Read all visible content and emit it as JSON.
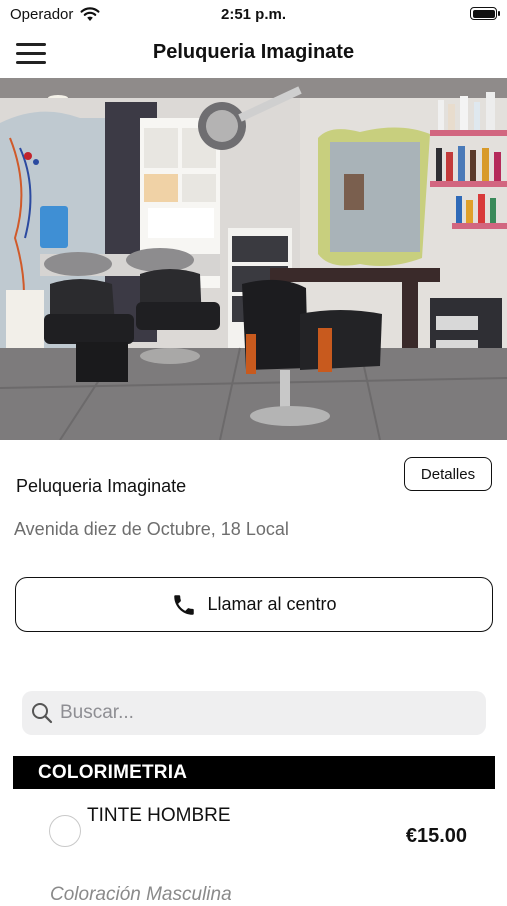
{
  "status_bar": {
    "carrier": "Operador",
    "time": "2:51 p.m."
  },
  "nav": {
    "title": "Peluqueria Imaginate",
    "menu_icon": "hamburger-menu-icon"
  },
  "hero": {
    "image_type": "photo of hair salon interior"
  },
  "salon": {
    "name": "Peluqueria Imaginate",
    "address": "Avenida diez de Octubre, 18 Local",
    "details_label": "Detalles",
    "call_label": "Llamar al centro",
    "call_icon": "phone-icon"
  },
  "search": {
    "placeholder": "Buscar...",
    "value": "",
    "icon": "search-icon"
  },
  "categories": [
    {
      "name": "COLORIMETRIA",
      "services": [
        {
          "name": "TINTE HOMBRE",
          "price": "€15.00",
          "description": "Coloración Masculina",
          "selected": false
        }
      ]
    }
  ]
}
